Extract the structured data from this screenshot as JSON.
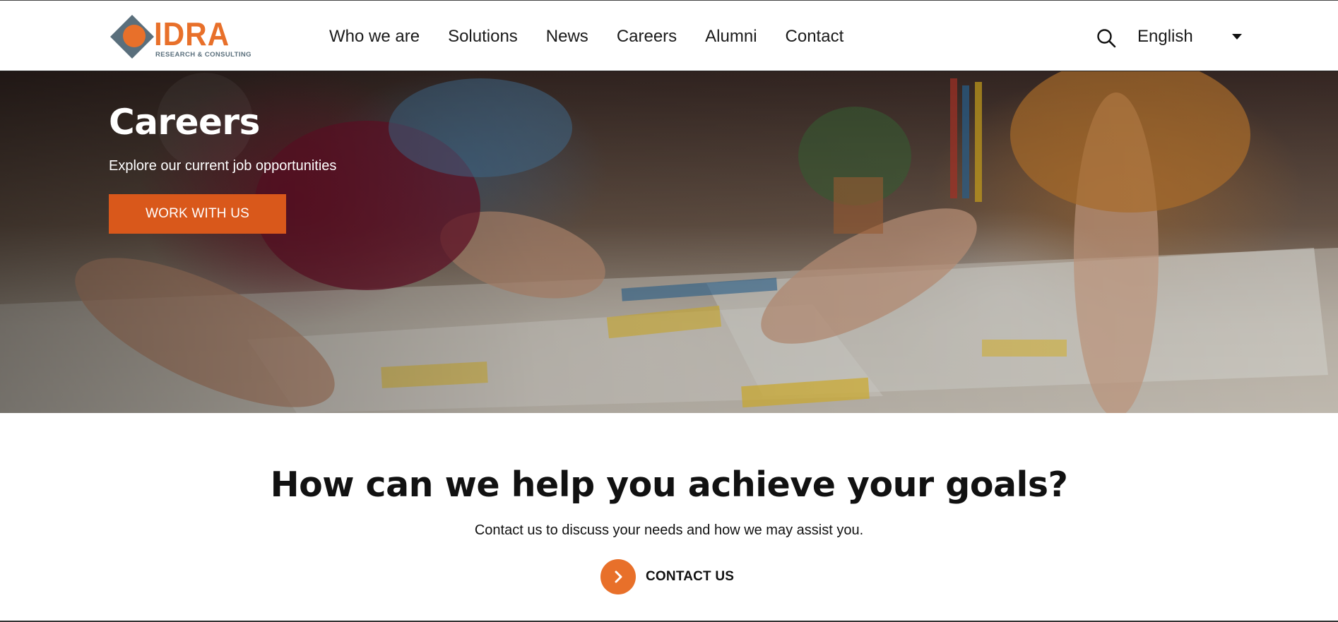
{
  "header": {
    "logo": {
      "name": "IDRA",
      "tagline": "RESEARCH & CONSULTING"
    },
    "nav": [
      {
        "label": "Who we are"
      },
      {
        "label": "Solutions"
      },
      {
        "label": "News"
      },
      {
        "label": "Careers"
      },
      {
        "label": "Alumni"
      },
      {
        "label": "Contact"
      }
    ],
    "search_icon": "search-icon",
    "language": {
      "selected": "English",
      "icon": "caret-down-icon"
    }
  },
  "hero": {
    "title": "Careers",
    "subtitle": "Explore our current job opportunities",
    "button_label": "WORK WITH US"
  },
  "cta": {
    "title": "How can we help you achieve your goals?",
    "subtitle": "Contact us to discuss your needs and how we may assist you.",
    "link_label": "CONTACT US",
    "link_icon": "chevron-right-icon"
  },
  "colors": {
    "brand_orange": "#e8702a",
    "button_orange": "#d9581b",
    "logo_slate": "#5a6f7c"
  }
}
